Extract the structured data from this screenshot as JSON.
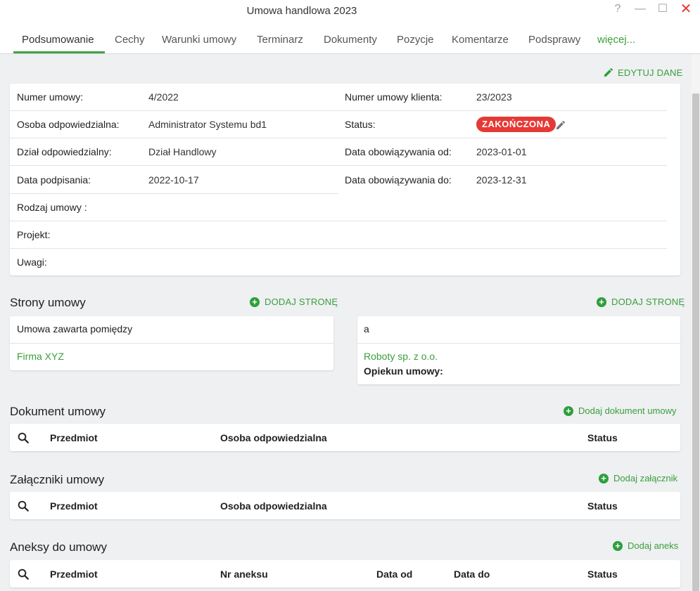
{
  "window": {
    "title": "Umowa handlowa 2023",
    "help_glyph": "?",
    "minimize_glyph": "—",
    "maximize_glyph": "☐",
    "close_glyph": "✕"
  },
  "tabs": [
    {
      "label": "Podsumowanie"
    },
    {
      "label": "Cechy"
    },
    {
      "label": "Warunki umowy"
    },
    {
      "label": "Terminarz"
    },
    {
      "label": "Dokumenty"
    },
    {
      "label": "Pozycje"
    },
    {
      "label": "Komentarze"
    },
    {
      "label": "Podsprawy"
    },
    {
      "label": "więcej..."
    }
  ],
  "actions": {
    "edit_data": "EDYTUJ DANE"
  },
  "summary": {
    "contract_number_label": "Numer umowy:",
    "contract_number": "4/2022",
    "client_number_label": "Numer umowy klienta:",
    "client_number": "23/2023",
    "responsible_person_label": "Osoba odpowiedzialna:",
    "responsible_person": "Administrator Systemu bd1",
    "status_label": "Status:",
    "status": "ZAKOŃCZONA",
    "responsible_dept_label": "Dział odpowiedzialny:",
    "responsible_dept": "Dział Handlowy",
    "valid_from_label": "Data obowiązywania od:",
    "valid_from": "2023-01-01",
    "signed_label": "Data podpisania:",
    "signed": "2022-10-17",
    "valid_to_label": "Data obowiązywania do:",
    "valid_to": "2023-12-31",
    "contract_type_label": "Rodzaj umowy :",
    "project_label": "Projekt:",
    "notes_label": "Uwagi:"
  },
  "parties": {
    "title": "Strony umowy",
    "add_party": "DODAJ STRONĘ",
    "left_header": "Umowa zawarta pomiędzy",
    "left_company": "Firma XYZ",
    "right_header": "a",
    "right_company": "Roboty sp. z o.o.",
    "guardian_label": "Opiekun umowy:"
  },
  "document_section": {
    "title": "Dokument umowy",
    "add_label": "Dodaj dokument umowy",
    "columns": [
      "Przedmiot",
      "Osoba odpowiedzialna",
      "Status"
    ]
  },
  "attachments_section": {
    "title": "Załączniki umowy",
    "add_label": "Dodaj załącznik",
    "columns": [
      "Przedmiot",
      "Osoba odpowiedzialna",
      "Status"
    ]
  },
  "annexes_section": {
    "title": "Aneksy do umowy",
    "add_label": "Dodaj aneks",
    "columns": [
      "Przedmiot",
      "Nr aneksu",
      "Data od",
      "Data do",
      "Status"
    ]
  },
  "colors": {
    "accent_green": "#3b9e3b",
    "status_red": "#e53935",
    "close_red": "#e53935",
    "background": "#eef0f2"
  },
  "icons": {
    "edit": "pencil-icon",
    "add": "plus-circle-icon",
    "search": "search-icon",
    "status_edit": "pencil-icon"
  }
}
